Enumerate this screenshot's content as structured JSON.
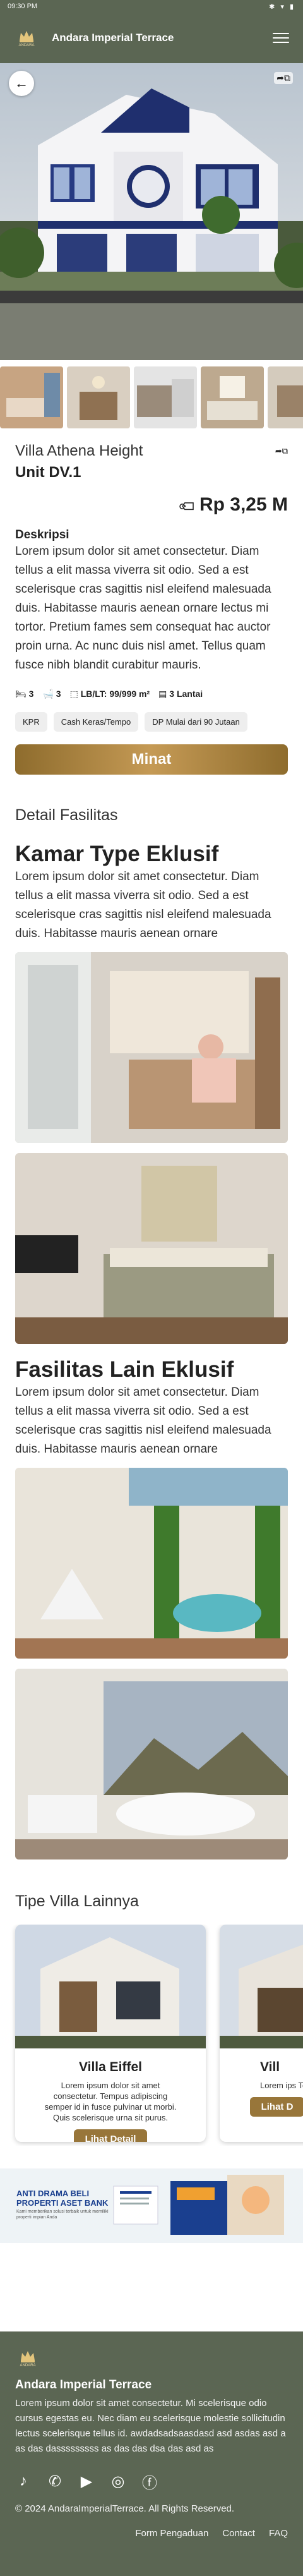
{
  "status_bar": {
    "time": "09:30 PM",
    "icons": "✱ ▾ ▮"
  },
  "app": {
    "title": "Andara Imperial Terrace",
    "logo_text": "ANDARA"
  },
  "hero": {
    "back_icon": "arrow-left-icon",
    "share_icon": "share-icon"
  },
  "property": {
    "name": "Villa Athena Height",
    "unit": "Unit DV.1",
    "price": "Rp 3,25 M",
    "desc_title": "Deskripsi",
    "description": "Lorem ipsum dolor sit amet consectetur. Diam tellus a elit massa viverra sit odio. Sed a est scelerisque cras sagittis nisl eleifend malesuada duis. Habitasse mauris aenean ornare lectus mi tortor. Pretium fames sem consequat hac auctor proin urna. Ac nunc duis nisl amet. Tellus quam fusce  nibh blandit curabitur mauris.",
    "specs": {
      "bed": "3",
      "bath": "3",
      "area": "LB/LT: 99/999 m²",
      "floors": "3 Lantai"
    },
    "chips": [
      "KPR",
      "Cash Keras/Tempo",
      "DP Mulai dari 90 Jutaan"
    ],
    "cta": "Minat"
  },
  "facilities": {
    "heading": "Detail Fasilitas",
    "room_title": "Kamar Type Eklusif",
    "room_desc": "Lorem ipsum dolor sit amet consectetur. Diam tellus a elit massa viverra sit odio. Sed a est scelerisque cras sagittis nisl eleifend malesuada duis. Habitasse mauris aenean ornare",
    "other_title": "Fasilitas Lain Eklusif",
    "other_desc": "Lorem ipsum dolor sit amet consectetur. Diam tellus a elit massa viverra sit odio. Sed a est scelerisque cras sagittis nisl eleifend malesuada duis. Habitasse mauris aenean ornare"
  },
  "others": {
    "heading": "Tipe Villa Lainnya",
    "cards": [
      {
        "name": "Villa Eiffel",
        "desc": "Lorem ipsum dolor sit amet consectetur. Tempus adipiscing semper id in fusce pulvinar ut morbi. Quis scelerisque urna sit purus.",
        "button": "Lihat Detail"
      },
      {
        "name": "Vill",
        "desc": "Lorem ips Tempus a pulvi",
        "button": "Lihat D"
      }
    ]
  },
  "banner": {
    "title": "ANTI DRAMA BELI PROPERTI ASET BANK",
    "sub": "Kami memberikan solusi terbaik untuk memiliki properti impian Anda"
  },
  "footer": {
    "name": "Andara Imperial Terrace",
    "desc": "Lorem ipsum dolor sit amet consectetur. Mi scelerisque odio cursus egestas eu. Nec diam eu scelerisque molestie sollicitudin lectus scelerisque tellus id. awdadsadsaasdasd asd asdas asd a as das dasssssssss as das das dsa das asd as",
    "copyright": "© 2024 AndaraImperialTerrace. All Rights Reserved.",
    "links": [
      "Form Pengaduan",
      "Contact",
      "FAQ"
    ],
    "social_icons": [
      "tiktok-icon",
      "whatsapp-icon",
      "youtube-icon",
      "instagram-icon",
      "facebook-icon"
    ]
  }
}
